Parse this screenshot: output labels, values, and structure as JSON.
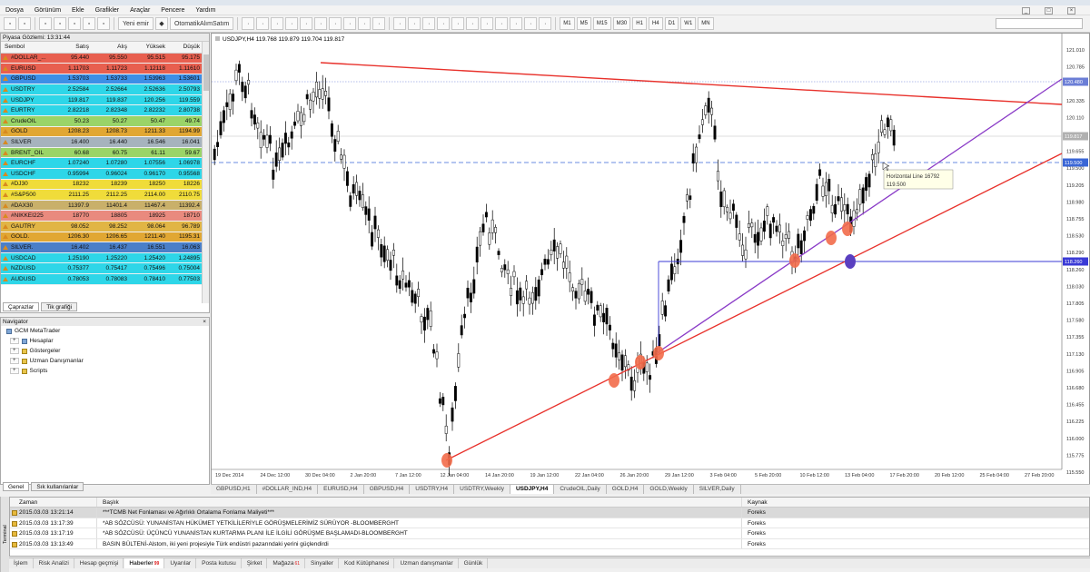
{
  "menu": [
    "Dosya",
    "Görünüm",
    "Ekle",
    "Grafikler",
    "Araçlar",
    "Pencere",
    "Yardım"
  ],
  "toolbar": {
    "new_order": "Yeni emir",
    "auto_trade": "OtomatikAlımSatım",
    "timeframes": [
      "M1",
      "M5",
      "M15",
      "M30",
      "H1",
      "H4",
      "D1",
      "W1",
      "MN"
    ]
  },
  "market_watch": {
    "title": "Piyasa Gözlemi: 13:31:44",
    "headers": [
      "Sembol",
      "Satış",
      "Alış",
      "Yüksek",
      "Düşük"
    ],
    "rows": [
      {
        "s": "#DOLLAR_...",
        "sell": "95.440",
        "buy": "95.550",
        "high": "95.515",
        "low": "95.175",
        "bg": "#e85f4f"
      },
      {
        "s": "EURUSD",
        "sell": "1.11703",
        "buy": "1.11723",
        "high": "1.12118",
        "low": "1.11610",
        "bg": "#e85f4f"
      },
      {
        "s": "GBPUSD",
        "sell": "1.53703",
        "buy": "1.53733",
        "high": "1.53963",
        "low": "1.53601",
        "bg": "#3d8fe6"
      },
      {
        "s": "USDTRY",
        "sell": "2.52584",
        "buy": "2.52664",
        "high": "2.52636",
        "low": "2.50793",
        "bg": "#2ed6e8"
      },
      {
        "s": "USDJPY",
        "sell": "119.817",
        "buy": "119.837",
        "high": "120.256",
        "low": "119.559",
        "bg": "#2ed6e8"
      },
      {
        "s": "EURTRY",
        "sell": "2.82218",
        "buy": "2.82348",
        "high": "2.82232",
        "low": "2.80738",
        "bg": "#2ed6e8"
      },
      {
        "s": "CrudeOIL",
        "sell": "50.23",
        "buy": "50.27",
        "high": "50.47",
        "low": "49.74",
        "bg": "#9ad468"
      },
      {
        "s": "GOLD",
        "sell": "1208.23",
        "buy": "1208.73",
        "high": "1211.33",
        "low": "1194.99",
        "bg": "#e1a733"
      },
      {
        "s": "SILVER",
        "sell": "16.400",
        "buy": "16.440",
        "high": "16.546",
        "low": "16.041",
        "bg": "#a6b3bd"
      },
      {
        "s": "BRENT_OIL",
        "sell": "60.68",
        "buy": "60.75",
        "high": "61.11",
        "low": "59.67",
        "bg": "#9ad468"
      },
      {
        "s": "EURCHF",
        "sell": "1.07240",
        "buy": "1.07280",
        "high": "1.07556",
        "low": "1.06978",
        "bg": "#2ed6e8"
      },
      {
        "s": "USDCHF",
        "sell": "0.95994",
        "buy": "0.96024",
        "high": "0.96170",
        "low": "0.95568",
        "bg": "#2ed6e8"
      },
      {
        "s": "#DJ30",
        "sell": "18232",
        "buy": "18239",
        "high": "18250",
        "low": "18226",
        "bg": "#f0dc3a"
      },
      {
        "s": "#S&P500",
        "sell": "2111.25",
        "buy": "2112.25",
        "high": "2114.00",
        "low": "2110.75",
        "bg": "#f0dc3a"
      },
      {
        "s": "#DAX30",
        "sell": "11397.9",
        "buy": "11401.4",
        "high": "11467.4",
        "low": "11392.4",
        "bg": "#c9b06a"
      },
      {
        "s": "#NIKKEI225",
        "sell": "18770",
        "buy": "18805",
        "high": "18925",
        "low": "18710",
        "bg": "#e98a7e"
      },
      {
        "s": "GAUTRY",
        "sell": "98.052",
        "buy": "98.252",
        "high": "98.064",
        "low": "96.789",
        "bg": "#e1b545"
      },
      {
        "s": "GOLD.",
        "sell": "1206.30",
        "buy": "1206.65",
        "high": "1211.40",
        "low": "1195.31",
        "bg": "#e1a733"
      },
      {
        "s": "SILVER.",
        "sell": "16.402",
        "buy": "16.437",
        "high": "16.551",
        "low": "16.063",
        "bg": "#4a7fc8"
      },
      {
        "s": "USDCAD",
        "sell": "1.25190",
        "buy": "1.25220",
        "high": "1.25420",
        "low": "1.24895",
        "bg": "#2ed6e8"
      },
      {
        "s": "NZDUSD",
        "sell": "0.75377",
        "buy": "0.75417",
        "high": "0.75496",
        "low": "0.75004",
        "bg": "#2ed6e8"
      },
      {
        "s": "AUDUSD",
        "sell": "0.78053",
        "buy": "0.78083",
        "high": "0.78410",
        "low": "0.77503",
        "bg": "#2ed6e8"
      }
    ],
    "tabs": [
      "Çaprazlar",
      "Tik grafiği"
    ]
  },
  "navigator": {
    "title": "Navigator",
    "root": "GCM MetaTrader",
    "items": [
      "Hesaplar",
      "Göstergeler",
      "Uzman Danışmanlar",
      "Scripts"
    ],
    "tabs": [
      "Genel",
      "Sık kullanılanlar"
    ]
  },
  "chart": {
    "header": "USDJPY,H4  119.768 119.879 119.704 119.817",
    "price_labels": [
      "121.010",
      "120.785",
      "120.480",
      "120.335",
      "120.110",
      "119.817",
      "119.655",
      "119.500",
      "119.205",
      "118.980",
      "118.755",
      "118.530",
      "118.290",
      "118.260",
      "118.030",
      "117.805",
      "117.580",
      "117.355",
      "117.130",
      "116.905",
      "116.680",
      "116.455",
      "116.225",
      "116.000",
      "115.775",
      "115.550"
    ],
    "time_labels": [
      "19 Dec 2014",
      "24 Dec 12:00",
      "30 Dec 04:00",
      "2 Jan 20:00",
      "7 Jan 12:00",
      "12 Jan 04:00",
      "14 Jan 20:00",
      "19 Jan 12:00",
      "22 Jan 04:00",
      "26 Jan 20:00",
      "29 Jan 12:00",
      "3 Feb 04:00",
      "5 Feb 20:00",
      "10 Feb 12:00",
      "13 Feb 04:00",
      "17 Feb 20:00",
      "20 Feb 12:00",
      "25 Feb 04:00",
      "27 Feb 20:00"
    ],
    "tooltip_line1": "Horizontal Line 16792",
    "tooltip_line2": "119.500",
    "tag_top": "120.480",
    "tag_mid": "119.817",
    "tag_hl": "119.500",
    "tag_low": "118.260",
    "candle_color": "#000000",
    "down_line_color": "#e8312b",
    "up_line_color": "#8a3bc7"
  },
  "chart_tabs": [
    "GBPUSD,H1",
    "#DOLLAR_IND,H4",
    "EURUSD,H4",
    "GBPUSD,H4",
    "USDTRY,H4",
    "USDTRY,Weekly",
    "USDJPY,H4",
    "CrudeOIL,Daily",
    "GOLD,H4",
    "GOLD,Weekly",
    "SILVER,Daily"
  ],
  "news": {
    "headers": [
      "Zaman",
      "Başlık",
      "Kaynak"
    ],
    "rows": [
      {
        "time": "2015.03.03 13:21:14",
        "title": "***TCMB Net Fonlaması ve Ağırlıklı Ortalama Fonlama Maliyeti***",
        "src": "Foreks"
      },
      {
        "time": "2015.03.03 13:17:39",
        "title": "*AB SÖZCÜSÜ: YUNANİSTAN HÜKÜMET YETKİLİLERİYLE GÖRÜŞMELERİMİZ SÜRÜYOR -BLOOMBERGHT",
        "src": "Foreks"
      },
      {
        "time": "2015.03.03 13:17:19",
        "title": "*AB SÖZCÜSÜ: ÜÇÜNCÜ YUNANİSTAN KURTARMA PLANI İLE İLGİLİ GÖRÜŞME BAŞLAMADI-BLOOMBERGHT",
        "src": "Foreks"
      },
      {
        "time": "2015.03.03 13:13:49",
        "title": "BASIN BÜLTENİ-Alstom, iki yeni projesiyle Türk endüstri pazarındaki yerini güçlendirdi",
        "src": "Foreks"
      }
    ]
  },
  "terminal_label": "Terminal",
  "bottom_tabs": [
    {
      "label": "İşlem"
    },
    {
      "label": "Risk Analizi"
    },
    {
      "label": "Hesap geçmişi"
    },
    {
      "label": "Haberler",
      "badge": "99"
    },
    {
      "label": "Uyarılar"
    },
    {
      "label": "Posta kutusu"
    },
    {
      "label": "Şirket"
    },
    {
      "label": "Mağaza",
      "badge": "61"
    },
    {
      "label": "Sinyaller"
    },
    {
      "label": "Kod Kütüphanesi"
    },
    {
      "label": "Uzman danışmanlar"
    },
    {
      "label": "Günlük"
    }
  ]
}
